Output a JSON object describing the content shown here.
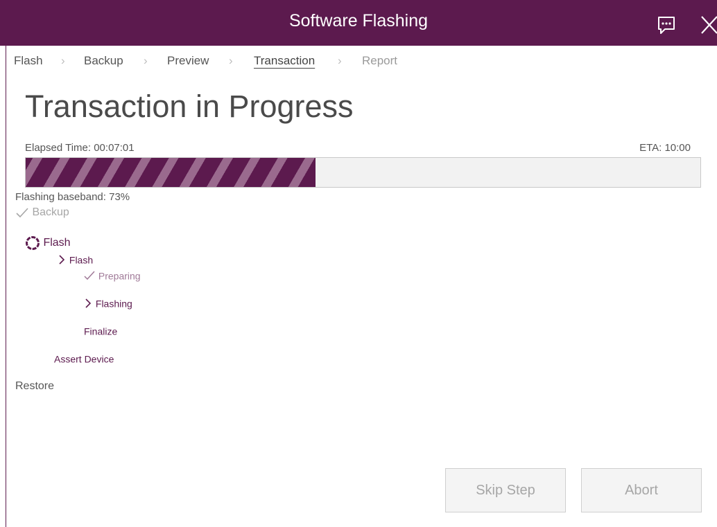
{
  "window": {
    "title": "Software Flashing"
  },
  "breadcrumb": [
    {
      "label": "Flash",
      "state": "done"
    },
    {
      "label": "Backup",
      "state": "done"
    },
    {
      "label": "Preview",
      "state": "done"
    },
    {
      "label": "Transaction",
      "state": "active"
    },
    {
      "label": "Report",
      "state": "disabled"
    }
  ],
  "page": {
    "title": "Transaction in Progress"
  },
  "progress": {
    "elapsed": "Elapsed Time: 00:07:01",
    "eta": "ETA: 10:00",
    "fill_fraction": 0.43,
    "status": "Flashing baseband: 73%"
  },
  "steps": {
    "backup": {
      "label": "Backup",
      "icon": "check-icon",
      "state": "done"
    },
    "flash": {
      "label": "Flash",
      "icon": "spinner-icon",
      "state": "in-progress"
    },
    "flash_sub": {
      "label": "Flash",
      "icon": "chevron-right-icon",
      "state": "in-progress"
    },
    "preparing": {
      "label": "Preparing",
      "icon": "check-icon",
      "state": "done"
    },
    "flashing": {
      "label": "Flashing",
      "icon": "chevron-right-icon",
      "state": "in-progress"
    },
    "finalize": {
      "label": "Finalize",
      "state": "pending"
    },
    "assert_device": {
      "label": "Assert Device",
      "state": "pending"
    },
    "restore": {
      "label": "Restore",
      "state": "pending"
    }
  },
  "buttons": {
    "skip": "Skip Step",
    "abort": "Abort"
  },
  "colors": {
    "accent": "#5c1a4e",
    "stripe_light": "#9a6a8e",
    "muted": "#a6a6a6"
  }
}
